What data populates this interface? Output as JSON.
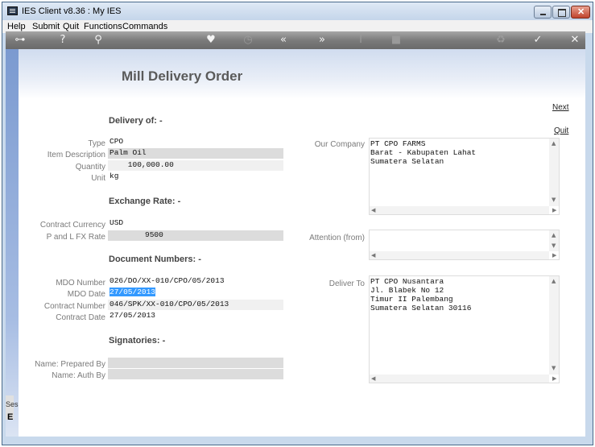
{
  "window": {
    "title": "IES Client v8.36 : My IES"
  },
  "menu": [
    "Help",
    "Submit",
    "Quit",
    "Functions",
    "Commands"
  ],
  "toolbar": {
    "icons": [
      "key-icon",
      "help-icon",
      "search-icon",
      "heart-icon",
      "clock-icon",
      "rewind-icon",
      "forward-icon",
      "text-cursor-icon",
      "stop-icon",
      "recycle-icon",
      "check-icon",
      "close-icon"
    ]
  },
  "page": {
    "title": "Mill Delivery Order",
    "next_label": "Next",
    "quit_label": "Quit"
  },
  "sections": {
    "delivery": "Delivery of: -",
    "exchange": "Exchange Rate: -",
    "documents": "Document Numbers: -",
    "signatories": "Signatories: -"
  },
  "delivery": {
    "type_label": "Type",
    "type_value": "CPO",
    "item_label": "Item Description",
    "item_value": "Palm Oil",
    "qty_label": "Quantity",
    "qty_value": "    100,000.00",
    "unit_label": "Unit",
    "unit_value": "kg"
  },
  "exchange": {
    "currency_label": "Contract Currency",
    "currency_value": "USD",
    "fx_label": "P and L  FX Rate",
    "fx_value": "9500"
  },
  "documents": {
    "mdo_number_label": "MDO Number",
    "mdo_number_value": "026/DO/XX-010/CPO/05/2013",
    "mdo_date_label": "MDO Date",
    "mdo_date_value": "27/05/2013",
    "contract_number_label": "Contract Number",
    "contract_number_value": "046/SPK/XX-010/CPO/05/2013",
    "contract_date_label": "Contract Date",
    "contract_date_value": "27/05/2013"
  },
  "signatories": {
    "prepared_label": "Name: Prepared By",
    "prepared_value": "",
    "auth_label": "Name: Auth By",
    "auth_value": ""
  },
  "right": {
    "our_company_label": "Our Company",
    "our_company_lines": [
      "PT CPO FARMS",
      "Barat - Kabupaten Lahat",
      "Sumatera Selatan"
    ],
    "attention_label": "Attention (from)",
    "attention_value": "",
    "deliver_to_label": "Deliver To",
    "deliver_to_lines": [
      "PT CPO Nusantara",
      "Jl. Blabek No 12",
      "Timur II Palembang",
      "Sumatera Selatan 30116"
    ]
  },
  "status": {
    "text": "Ses"
  }
}
